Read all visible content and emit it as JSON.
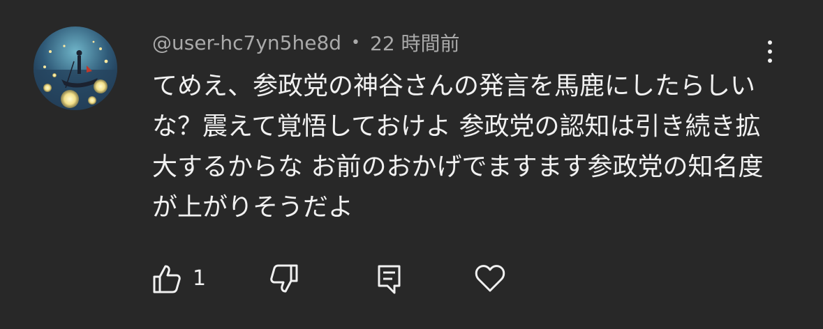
{
  "comment": {
    "author": "@user-hc7yn5he8d",
    "separator": "•",
    "timestamp": "22 時間前",
    "text": "てめえ、参政党の神谷さんの発言を馬鹿にしたらしいな？震えて覚悟しておけよ 参政党の認知は引き続き拡大するからな お前のおかげでますます参政党の知名度が上がりそうだよ",
    "like_count": "1"
  },
  "icons": {
    "avatar": "avatar-boat-lanterns",
    "more": "vertical-ellipsis-icon",
    "like": "thumbs-up-icon",
    "dislike": "thumbs-down-icon",
    "reply": "reply-comment-icon",
    "heart": "heart-icon"
  },
  "colors": {
    "background": "#282828",
    "text_primary": "#f1f1f1",
    "text_secondary": "#aaaaaa"
  }
}
